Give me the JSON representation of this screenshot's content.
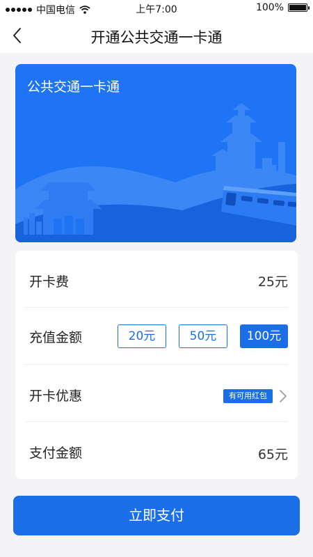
{
  "status_bar": {
    "carrier": "中国电信",
    "time": "上午7:00",
    "battery": "100%",
    "battery_level": 1.0
  },
  "nav": {
    "title": "开通公共交通一卡通",
    "back_icon": "chevron-left-icon"
  },
  "card": {
    "title": "公共交通一卡通",
    "colors": {
      "background": "#1e74f4",
      "hill_light": "#3c89f7",
      "hill_dark": "#175fd8"
    }
  },
  "form": {
    "open_fee": {
      "label": "开卡费",
      "value": "25元"
    },
    "recharge": {
      "label": "充值金额",
      "options": [
        "20元",
        "50元",
        "100元"
      ],
      "selected_index": 2
    },
    "discount": {
      "label": "开卡优惠",
      "badge": "有可用红包"
    },
    "payment": {
      "label": "支付金额",
      "value": "65元"
    }
  },
  "pay_button": {
    "label": "立即支付"
  },
  "colors": {
    "accent": "#1a6fe8",
    "page_bg": "#f4f4f6"
  }
}
